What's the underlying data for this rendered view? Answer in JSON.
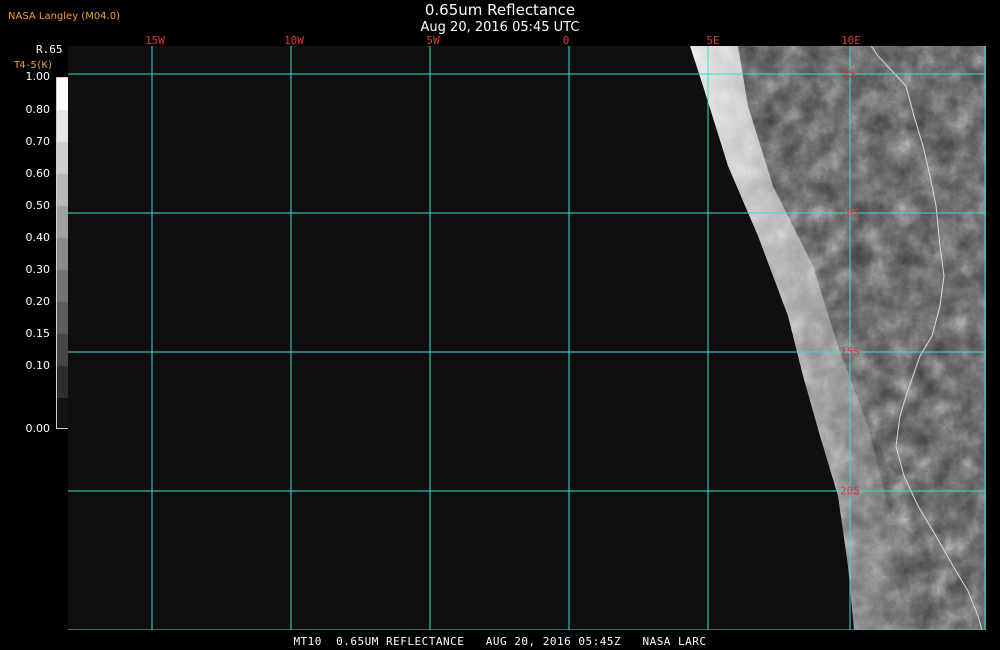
{
  "header": {
    "title": "0.65um Reflectance",
    "subtitle": "Aug 20, 2016 05:45 UTC",
    "provider": "NASA Langley (M04.0)"
  },
  "legend": {
    "label_primary": "R.65",
    "label_secondary": "T4-5(K)",
    "ticks": [
      "1.00",
      "0.80",
      "0.70",
      "0.60",
      "0.50",
      "0.40",
      "0.30",
      "0.20",
      "0.15",
      "0.10",
      "0.00"
    ]
  },
  "grid": {
    "longitude_labels": [
      "15W",
      "10W",
      "5W",
      "0",
      "5E",
      "10E"
    ],
    "latitude_labels": [
      "5S",
      "10S",
      "15S",
      "20S"
    ],
    "line_color": "#3ed8d8",
    "label_color": "#d83a3a"
  },
  "footer": {
    "text": "MT10  0.65UM REFLECTANCE   AUG 20, 2016 05:45Z   NASA LARC"
  },
  "colors": {
    "background": "#000000",
    "space": "#0f0f0f",
    "title_text": "#ffffff",
    "provider_text": "#f0a030",
    "coastline": "#d8d8d8"
  }
}
